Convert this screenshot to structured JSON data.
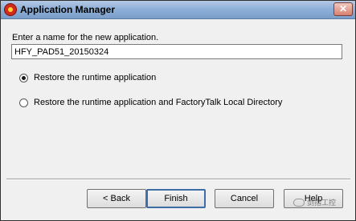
{
  "window": {
    "title": "Application Manager",
    "close_glyph": "✕"
  },
  "form": {
    "prompt": "Enter a name for the new application.",
    "name_value": "HFY_PAD51_20150324",
    "options": [
      {
        "label": "Restore the runtime application",
        "checked": true
      },
      {
        "label": "Restore the runtime application and FactoryTalk Local Directory",
        "checked": false
      }
    ]
  },
  "buttons": {
    "back": "< Back",
    "finish": "Finish",
    "cancel": "Cancel",
    "help": "Help"
  },
  "watermark": {
    "text": "剑指工控"
  },
  "icons": {
    "app": "application-manager-icon",
    "close": "close-icon"
  }
}
